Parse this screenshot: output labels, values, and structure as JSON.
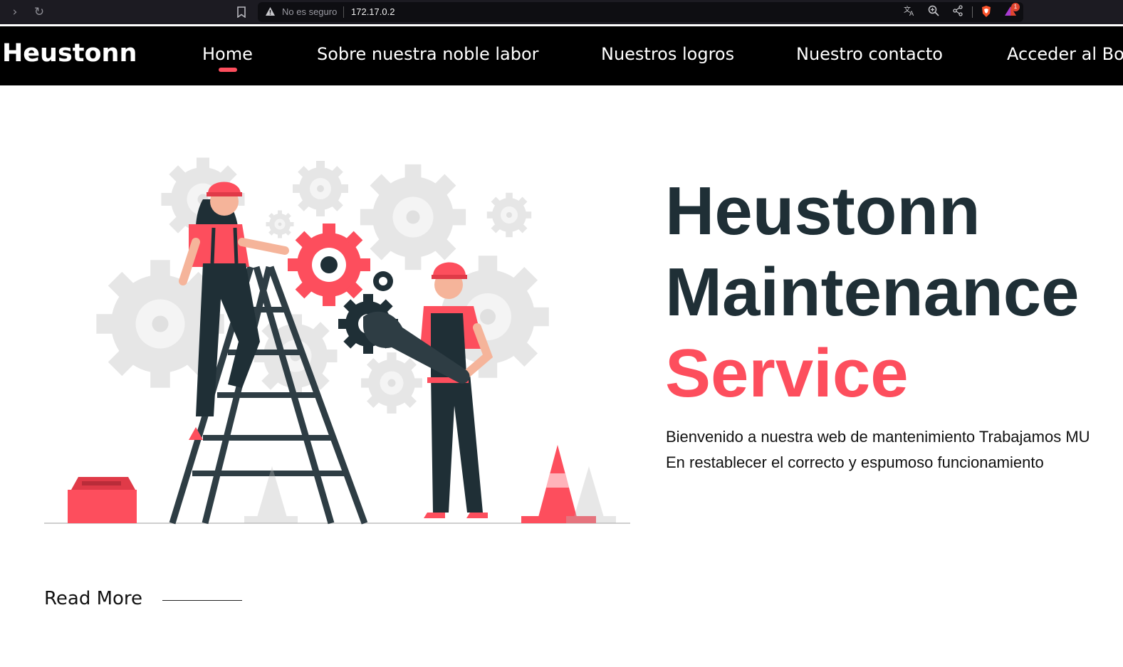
{
  "browser": {
    "security_label": "No es seguro",
    "url": "172.17.0.2",
    "notification_count": "1"
  },
  "nav": {
    "brand": "Heustonn",
    "items": [
      {
        "label": "Home",
        "active": true
      },
      {
        "label": "Sobre nuestra noble labor",
        "active": false
      },
      {
        "label": "Nuestros logros",
        "active": false
      },
      {
        "label": "Nuestro contacto",
        "active": false
      },
      {
        "label": "Acceder al Bo",
        "active": false
      }
    ]
  },
  "hero": {
    "title_line1": "Heustonn",
    "title_line2": "Maintenance",
    "title_accent": "Service",
    "desc_line1": "Bienvenido a nuestra web de mantenimiento Trabajamos MU",
    "desc_line2": "En restablecer el correcto y espumoso funcionamiento",
    "read_more": "Read More"
  },
  "colors": {
    "accent": "#fd4e5d",
    "dark": "#1f2f36",
    "nav_bg": "#000000"
  }
}
